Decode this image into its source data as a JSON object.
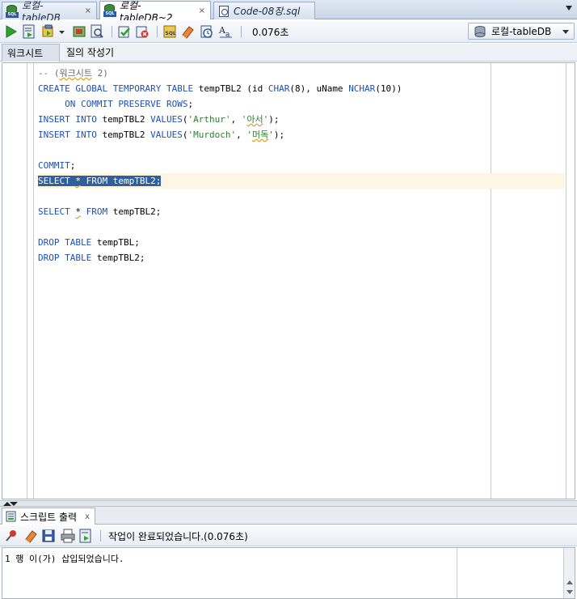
{
  "tabs": [
    {
      "label": "로컬-tableDB",
      "active": false
    },
    {
      "label": "로컬-tableDB~2",
      "active": true
    },
    {
      "label": "Code-08장.sql",
      "active": false
    }
  ],
  "tab_close_glyph": "×",
  "toolbar": {
    "elapsed": "0.076초",
    "connection": "로컬-tableDB",
    "icons": [
      "run-statement-icon",
      "run-script-icon",
      "commit-icon",
      "dropdown-icon",
      "explain-plan-icon",
      "autotrace-icon",
      "commit-transaction-icon",
      "rollback-icon",
      "sql-tuning-icon",
      "clear-icon",
      "history-icon",
      "format-case-icon"
    ]
  },
  "subtabs": {
    "worksheet": "워크시트",
    "query_builder": "질의 작성기"
  },
  "editor": {
    "lines": [
      "-- (워크시트 2)",
      "CREATE GLOBAL TEMPORARY TABLE tempTBL2 (id CHAR(8), uName NCHAR(10))",
      "     ON COMMIT PRESERVE ROWS;",
      "INSERT INTO tempTBL2 VALUES('Arthur', '아서');",
      "INSERT INTO tempTBL2 VALUES('Murdoch', '머독');",
      "",
      "COMMIT;",
      "SELECT * FROM tempTBL2;",
      "",
      "SELECT * FROM tempTBL2;",
      "",
      "DROP TABLE tempTBL;",
      "DROP TABLE tempTBL2;"
    ],
    "current_line_index": 7
  },
  "output": {
    "tab_label": "스크립트 출력",
    "tab_close_glyph": "x",
    "message": "작업이 완료되었습니다.(0.076초)",
    "result": "1 행 이(가) 삽입되었습니다."
  },
  "colors": {
    "keyword": "#1e4fb4",
    "string": "#2e7d2e",
    "selection": "#2f5f9c",
    "current_line": "#fdf6e3"
  }
}
